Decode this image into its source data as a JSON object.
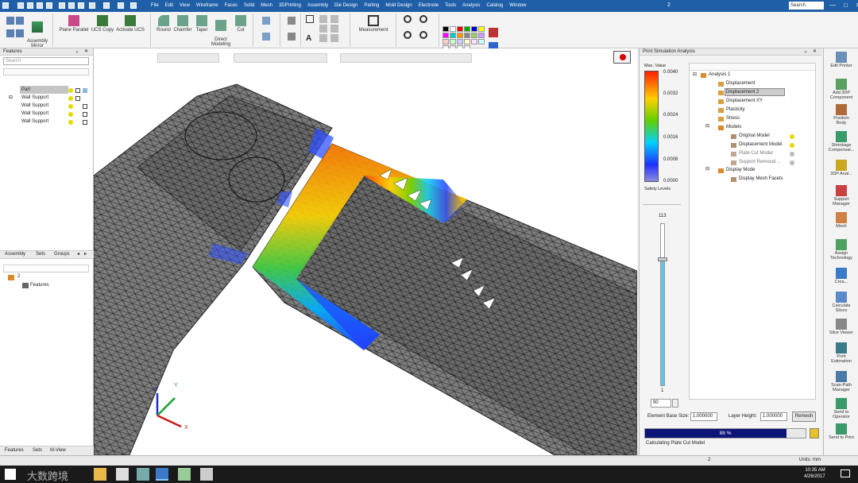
{
  "window": {
    "title_number": "2",
    "search_placeholder": "Search",
    "controls": [
      "—",
      "□",
      "✕"
    ]
  },
  "menu": [
    "File",
    "Edit",
    "View",
    "Wireframe",
    "Faces",
    "Solid",
    "Mesh",
    "3DPrinting",
    "Assembly",
    "Die Design",
    "Parting",
    "Mold Design",
    "Electrode",
    "Tools",
    "Analysis",
    "Catalog",
    "Window"
  ],
  "ribbon": {
    "assembly_mirror": "Assembly\nMirror",
    "plane_parallel": "Plane Parallel",
    "ucs_copy": "UCS Copy",
    "activate_ucs": "Activate UCS",
    "round": "Round",
    "chamfer": "Chamfer",
    "taper": "Taper",
    "direct_modeling": "Direct\nModeling",
    "cut": "Cut",
    "measurement": "Measurement"
  },
  "features_panel": {
    "title": "Features",
    "search_placeholder": "Search",
    "items": [
      "Part",
      "Wall Support",
      "Wall Support",
      "Wall Support",
      "Wall Support"
    ],
    "tabs": [
      "Assembly",
      "Sets",
      "Groups"
    ],
    "tree_root": "2",
    "tree_child": "Features",
    "bottom_tabs": [
      "Features",
      "Sets",
      "M-View"
    ]
  },
  "analysis_panel": {
    "title": "Print Simulation Analysis",
    "max_value_label": "Max. Value",
    "legend_values": [
      "0.0040",
      "0.0032",
      "0.0024",
      "0.0016",
      "0.0008",
      "0.0000"
    ],
    "safety_levels": "Safety Levels",
    "slider_max": "113",
    "slider_min": "1",
    "slider_value": "90",
    "tree": {
      "root": "Analysis 1",
      "items": [
        "Displacement",
        "Displacement 2",
        "Displacement XY",
        "Plasticity",
        "Stress"
      ],
      "models": "Models",
      "model_items": [
        "Original Model",
        "Displacement Model",
        "Plate Cut Model",
        "Support Removal ..."
      ],
      "display_mode": "Display Mode",
      "display_items": [
        "Display Mesh Facets"
      ]
    },
    "element_base_label": "Element Base Size:",
    "element_base_value": "1.000000",
    "layer_height_label": "Layer Height:",
    "layer_height_value": "1.000000",
    "remesh": "Remesh",
    "progress": 0.88,
    "progress_text": "88 %",
    "status": "Calculating Plate Cut Model",
    "accent": "#0c1478"
  },
  "right_toolbar": [
    "Edit Printer",
    "Add 3DP\nComponent",
    "Position\nBody",
    "Shrinkage\nCompensat...",
    "3DP Anal...",
    "Support\nManager",
    "Mesh",
    "Assign\nTechnology",
    "Crea...",
    "Calculate\nSlices",
    "Slice Viewer",
    "Print\nEstimation",
    "Scan-Path\nManager",
    "Send to\nOperator",
    "Send to Print"
  ],
  "axes": {
    "z": "Z",
    "y": "Y",
    "x": "X"
  },
  "statusbar": {
    "center": "2",
    "units": "Units: mm"
  },
  "taskbar": {
    "time": "10:35 AM",
    "date": "4/26/2017",
    "watermark": "大数跨境"
  }
}
